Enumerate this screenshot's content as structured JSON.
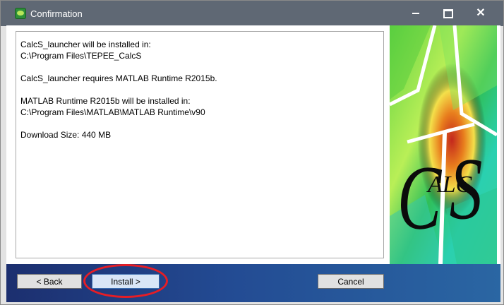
{
  "window": {
    "title": "Confirmation",
    "controls": {
      "minimize": "minimize",
      "maximize": "maximize",
      "close": "✕"
    }
  },
  "message": {
    "line1": "CalcS_launcher will be installed in:",
    "line2": "C:\\Program Files\\TEPEE_CalcS",
    "line3": "CalcS_launcher requires MATLAB Runtime R2015b.",
    "line4": "MATLAB Runtime R2015b will be installed in:",
    "line5": "C:\\Program Files\\MATLAB\\MATLAB Runtime\\v90",
    "line6": "Download Size: 440 MB"
  },
  "logo": {
    "brand_text": "CALCS"
  },
  "buttons": {
    "back": "< Back",
    "install": "Install >",
    "cancel": "Cancel"
  },
  "colors": {
    "titlebar": "#5f6874",
    "footer_gradient_start": "#1c2f6f",
    "footer_gradient_end": "#2a66a3",
    "highlight": "#e61d25"
  },
  "icons": {
    "app_icon": "calcs-app-icon",
    "minimize_icon": "minimize-icon",
    "maximize_icon": "maximize-icon",
    "close_icon": "close-icon"
  }
}
